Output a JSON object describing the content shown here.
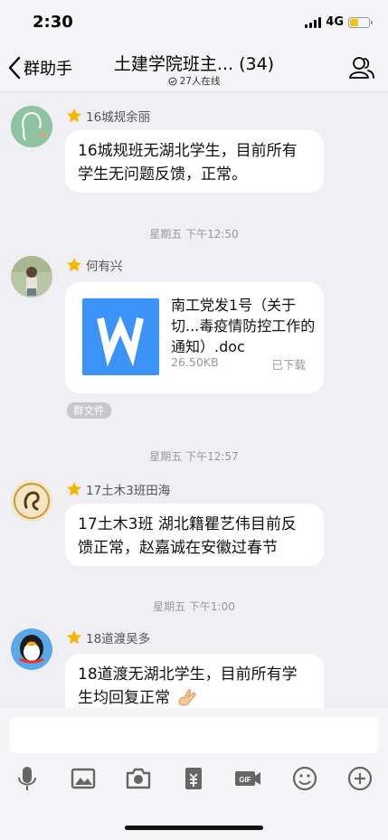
{
  "status_bar": {
    "time": "2:30",
    "network": "4G"
  },
  "nav": {
    "back_label": "群助手",
    "title": "土建学院班主... (34)",
    "online": "27人在线"
  },
  "messages": [
    {
      "sender": "16城规余丽",
      "text": "16城规班无湖北学生，目前所有学生无问题反馈，正常。"
    },
    {
      "timestamp": "星期五 下午12:50"
    },
    {
      "sender": "何有兴",
      "file_name": "南工党发1号（关于切...毒疫情防控工作的通知）.doc",
      "file_size": "26.50KB",
      "file_status": "已下载",
      "tag": "群文件"
    },
    {
      "timestamp": "星期五 下午12:57"
    },
    {
      "sender": "17土木3班田海",
      "text": "17土木3班 湖北籍瞿艺伟目前反馈正常，赵嘉诚在安徽过春节"
    },
    {
      "timestamp": "星期五 下午1:00"
    },
    {
      "sender": "18道渡吴多",
      "text": "18道渡无湖北学生，目前所有学生均回复正常"
    }
  ],
  "input": {
    "placeholder": ""
  },
  "colors": {
    "accent": "#3b93f7",
    "background": "#efeff4",
    "star": "#f7b500"
  },
  "icons": [
    "microphone-icon",
    "image-icon",
    "camera-icon",
    "red-packet-icon",
    "gif-icon",
    "emoji-icon",
    "plus-icon"
  ]
}
